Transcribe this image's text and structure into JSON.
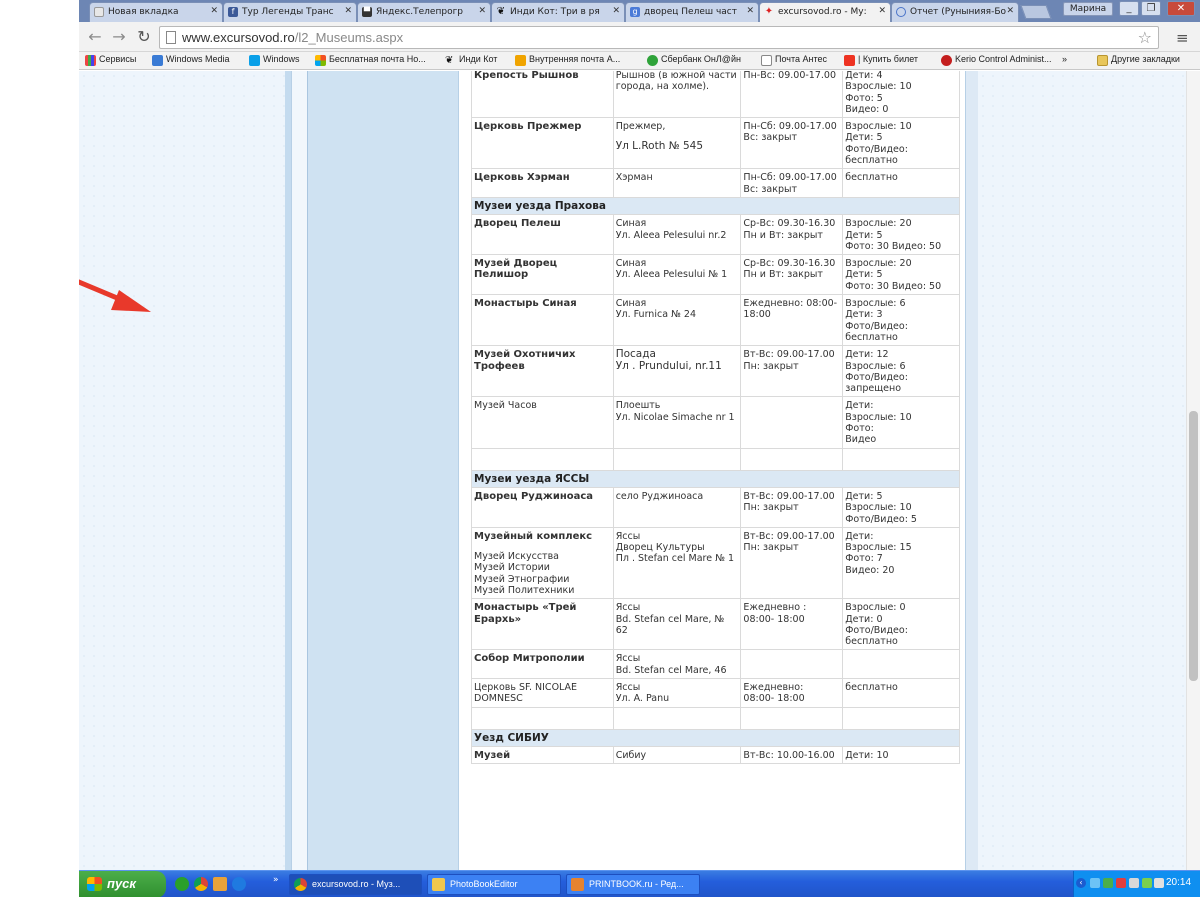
{
  "browser": {
    "tabs": [
      {
        "label": "Новая вкладка",
        "icon": "blank-page-icon",
        "active": false
      },
      {
        "label": "Тур Легенды Транс",
        "icon": "facebook-icon",
        "active": false
      },
      {
        "label": "Яндекс.Телепрогр",
        "icon": "tv-icon",
        "active": false
      },
      {
        "label": "Инди Кот: Три в ря",
        "icon": "paw-icon",
        "active": false
      },
      {
        "label": "дворец Пелеш част",
        "icon": "google-icon",
        "active": false
      },
      {
        "label": "excursovod.ro - Му:",
        "icon": "excursovod-icon",
        "active": true
      },
      {
        "label": "Отчет (Рунынияя-Бо",
        "icon": "globe-icon",
        "active": false
      }
    ],
    "user_label": "Марина",
    "url_domain": "www.excursovod.ro",
    "url_path": "/l2_Museums.aspx",
    "bookmarks": [
      {
        "label": "Сервисы",
        "icon": "apps-grid-icon"
      },
      {
        "label": "Windows Media",
        "icon": "windows-media-icon"
      },
      {
        "label": "Windows",
        "icon": "windows-icon"
      },
      {
        "label": "Бесплатная почта Ho...",
        "icon": "msn-icon"
      },
      {
        "label": "Инди Кот",
        "icon": "paw-icon"
      },
      {
        "label": "Внутренняя почта А...",
        "icon": "mail-icon"
      },
      {
        "label": "Сбербанк ОнЛ@йн",
        "icon": "sberbank-icon"
      },
      {
        "label": "Почта Антес",
        "icon": "page-icon"
      },
      {
        "label": "| Купить билет",
        "icon": "rzd-icon"
      },
      {
        "label": "Kerio Control Administ...",
        "icon": "kerio-icon"
      }
    ],
    "more_bookmarks": "»",
    "other_bookmarks": "Другие закладки"
  },
  "colors": {
    "section_bg": "#dbe8f4",
    "side_column": "#cfe2f2",
    "arrow": "#e8392b"
  },
  "museum_table": {
    "rows": [
      {
        "type": "museum",
        "name": "Крепость Рышнов",
        "bold": true,
        "address": "Рышнов (в южной части города, на холме).",
        "hours": "Пн-Вс: 09.00-17.00",
        "price": "Дети: 4\nВзрослые: 10\nФото: 5\nВидео: 0"
      },
      {
        "type": "museum",
        "name": "Церковь Прежмер",
        "bold": true,
        "address": "Прежмер,",
        "address2": "Ул L.Roth № 545",
        "hours": "Пн-Сб: 09.00-17.00\nВс: закрыт",
        "price": "Взрослые: 10\nДети: 5\nФото/Видео: бесплатно"
      },
      {
        "type": "museum",
        "name": "Церковь Хэрман",
        "bold": true,
        "address": "Хэрман",
        "hours": "Пн-Сб: 09.00-17.00\nВс: закрыт",
        "price": "бесплатно"
      },
      {
        "type": "section",
        "title": "Музеи уезда Прахова"
      },
      {
        "type": "museum",
        "name": "Дворец Пелеш",
        "bold": true,
        "address": "Синая\nУл. Aleea Pelesului nr.2",
        "hours": "Ср-Вс: 09.30-16.30\nПн и Вт: закрыт",
        "price": "Взрослые: 20\nДети: 5\nФото: 30 Видео: 50"
      },
      {
        "type": "museum",
        "name": "Музей Дворец Пелишор",
        "bold": true,
        "address": "Синая\nУл. Aleea Pelesului № 1",
        "hours": "Ср-Вс: 09.30-16.30\nПн и Вт: закрыт",
        "price": "Взрослые: 20\nДети: 5\nФото: 30 Видео: 50"
      },
      {
        "type": "museum",
        "name": "Монастырь Синая",
        "bold": true,
        "address": "Синая\nУл. Furnica № 24",
        "hours": "Ежедневно: 08:00- 18:00",
        "price": "Взрослые: 6\nДети: 3\nФото/Видео: бесплатно"
      },
      {
        "type": "museum",
        "name": "Музей Охотничих Трофеев",
        "bold": true,
        "address": "Посада\nУл . Prundului, nr.11",
        "address_big": true,
        "hours": "Вт-Вс: 09.00-17.00\nПн: закрыт",
        "price": "Дети: 12\nВзрослые: 6\nФото/Видео: запрещено"
      },
      {
        "type": "museum",
        "name": "Музей Часов",
        "bold": false,
        "address": "Плоешть\nУл. Nicolae Simache nr 1",
        "hours": "",
        "price": "Дети:\nВзрослые: 10\nФото:\nВидео"
      },
      {
        "type": "empty"
      },
      {
        "type": "section",
        "title": "Музеи уезда ЯССЫ"
      },
      {
        "type": "museum",
        "name": "Дворец Руджиноаса",
        "bold": true,
        "address": "село Руджиноаса",
        "hours": "Вт-Вс: 09.00-17.00\nПн: закрыт",
        "price": "Дети: 5\nВзрослые: 10\nФото/Видео: 5"
      },
      {
        "type": "museum",
        "name": "Музейный комплекс",
        "bold": true,
        "sub": "Музей Искусства\nМузей Истории\nМузей Этнографии\nМузей Политехники",
        "address": "Яссы\nДворец Культуры\nПл . Stefan cel Mare № 1",
        "hours": "Вт-Вс: 09.00-17.00\nПн: закрыт",
        "price": "Дети:\nВзрослые: 15\nФото: 7\nВидео: 20"
      },
      {
        "type": "museum",
        "name": "Монастырь «Трей Ерархь»",
        "bold": true,
        "address": "Яссы\nBd. Stefan cel Mare, № 62",
        "hours": "Ежедневно :\n08:00- 18:00",
        "price": "Взрослые: 0\nДети: 0\nФото/Видео: бесплатно"
      },
      {
        "type": "museum",
        "name": "Собор Митрополии",
        "bold": true,
        "address": "Яссы\nBd. Stefan cel Mare, 46",
        "hours": "",
        "price": ""
      },
      {
        "type": "museum",
        "name": "Церковь SF. NICOLAE DOMNESC",
        "bold": false,
        "address": "Яссы\nУл. A. Panu",
        "hours": "Ежедневно:\n08:00- 18:00",
        "price": "бесплатно"
      },
      {
        "type": "empty"
      },
      {
        "type": "section",
        "title": "Уезд СИБИУ"
      },
      {
        "type": "museum",
        "name": "Музей",
        "bold": true,
        "address": "Сибиу",
        "hours": "Вт-Вс: 10.00-16.00",
        "price": "Дети: 10"
      }
    ]
  },
  "taskbar": {
    "start_label": "пуск",
    "tasks": [
      {
        "label": "excursovod.ro - Муз...",
        "icon": "chrome-icon"
      },
      {
        "label": "PhotoBookEditor",
        "icon": "folder-icon"
      },
      {
        "label": "PRINTBOOK.ru - Ред...",
        "icon": "printbook-icon"
      }
    ],
    "clock": "20:14"
  }
}
